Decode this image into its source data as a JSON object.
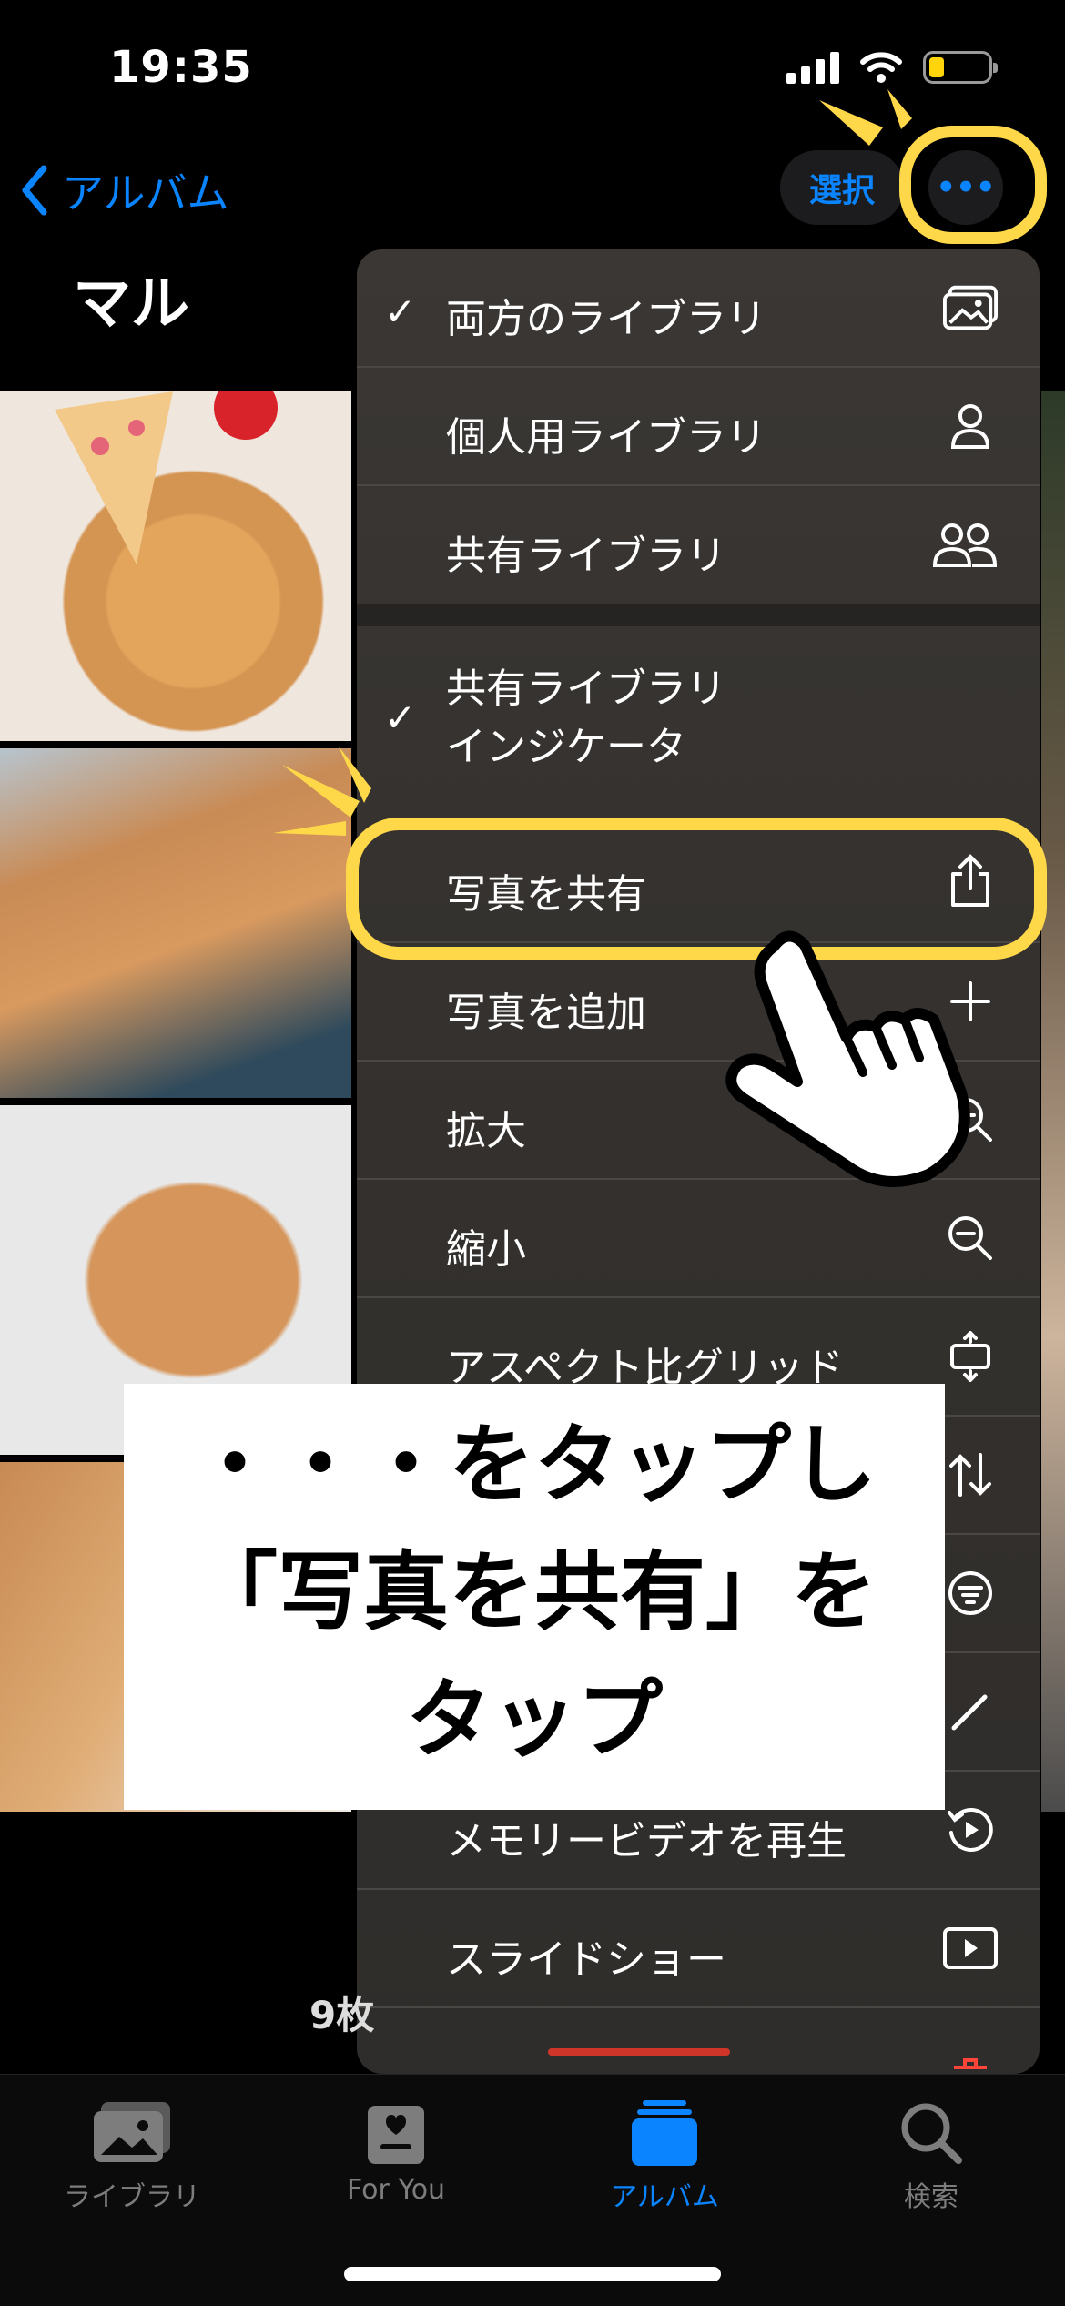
{
  "status_bar": {
    "time": "19:35"
  },
  "nav": {
    "back_label": "アルバム",
    "select_label": "選択",
    "more_label": "•••"
  },
  "album_title": "マル",
  "photo_count": "9枚",
  "menu": {
    "items": [
      {
        "label": "両方のライブラリ",
        "checked": true,
        "icon": "photos-library-icon"
      },
      {
        "label": "個人用ライブラリ",
        "checked": false,
        "icon": "person-icon"
      },
      {
        "label": "共有ライブラリ",
        "checked": false,
        "icon": "people-icon"
      },
      {
        "label": "共有ライブラリ",
        "label2": "インジケータ",
        "checked": true
      },
      {
        "label": "写真を共有",
        "icon": "share-icon"
      },
      {
        "label": "写真を追加",
        "icon": "plus-icon"
      },
      {
        "label": "拡大",
        "icon": "zoom-in-icon"
      },
      {
        "label": "縮小",
        "icon": "zoom-out-icon"
      },
      {
        "label": "アスペクト比グリッド",
        "icon": "aspect-grid-icon"
      },
      {
        "icon": "sort-icon"
      },
      {
        "icon": "filter-icon"
      },
      {
        "icon": "pencil-icon"
      },
      {
        "label": "メモリービデオを再生",
        "icon": "memory-play-icon"
      },
      {
        "label": "スライドショー",
        "icon": "slideshow-icon"
      }
    ]
  },
  "caption": {
    "line1": "・・・をタップし",
    "line2": "「写真を共有」を",
    "line3": "タップ"
  },
  "tabs": [
    {
      "label": "ライブラリ",
      "active": false
    },
    {
      "label": "For You",
      "active": false
    },
    {
      "label": "アルバム",
      "active": true
    },
    {
      "label": "検索",
      "active": false
    }
  ],
  "colors": {
    "accent": "#0a84ff",
    "highlight": "#ffd84a"
  }
}
